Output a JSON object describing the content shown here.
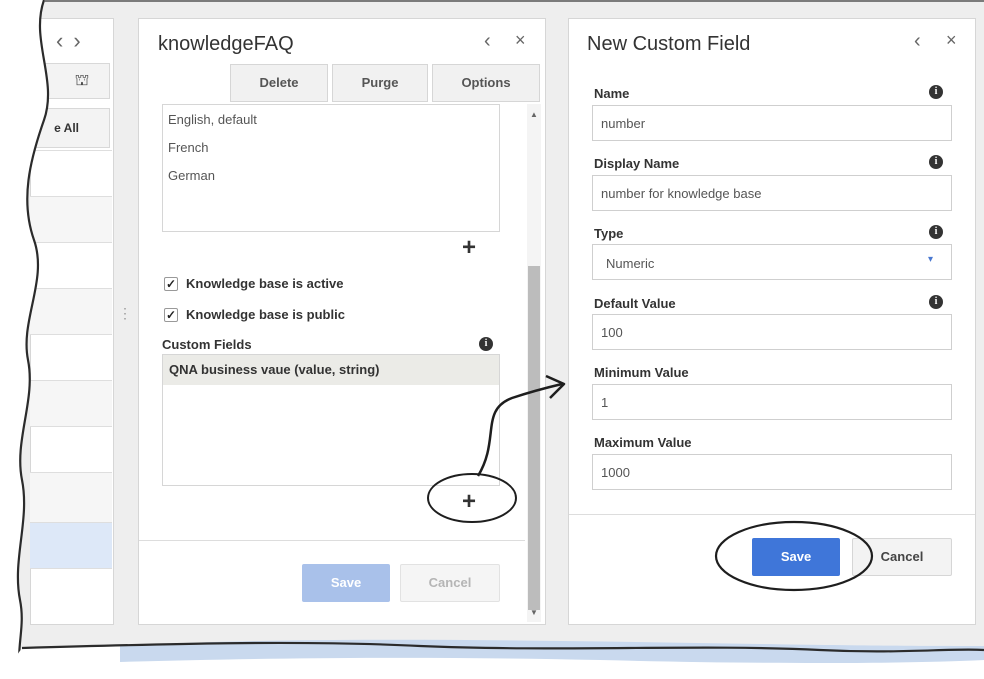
{
  "left_panel": {
    "nav_back": "‹",
    "nav_forward": "›",
    "bank_icon": "bank-icon",
    "partial_button": "e All"
  },
  "knowledge_panel": {
    "title": "knowledgeFAQ",
    "back_icon": "‹",
    "close_icon": "×",
    "toolbar": {
      "delete": "Delete",
      "purge": "Purge",
      "options": "Options"
    },
    "languages": [
      "English, default",
      "French",
      "German"
    ],
    "add_language": "+",
    "checkboxes": [
      {
        "label": "Knowledge base is active",
        "checked": true
      },
      {
        "label": "Knowledge base is public",
        "checked": true
      }
    ],
    "custom_fields_label": "Custom Fields",
    "custom_fields": [
      "QNA business vaue (value, string)"
    ],
    "add_custom_field": "+",
    "save": "Save",
    "cancel": "Cancel"
  },
  "custom_field_panel": {
    "title": "New Custom Field",
    "back_icon": "‹",
    "close_icon": "×",
    "name_label": "Name",
    "name_value": "number",
    "display_name_label": "Display Name",
    "display_name_value": "number for knowledge base",
    "type_label": "Type",
    "type_value": "Numeric",
    "default_value_label": "Default Value",
    "default_value": "100",
    "minimum_value_label": "Minimum Value",
    "minimum_value": "1",
    "maximum_value_label": "Maximum Value",
    "maximum_value": "1000",
    "save": "Save",
    "cancel": "Cancel"
  },
  "colors": {
    "accent": "#3f76d9",
    "accent_disabled": "#a9c1ea",
    "border": "#d6d6d6",
    "selected_row": "#ebebe7"
  }
}
